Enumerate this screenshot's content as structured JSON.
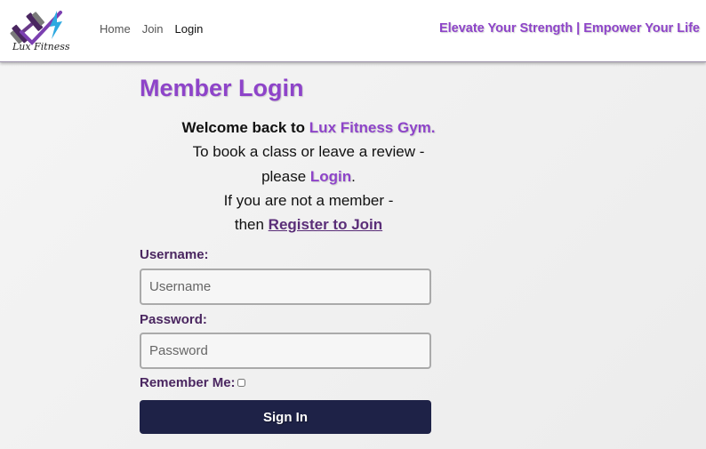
{
  "header": {
    "logo_text": "Lux Fitness",
    "nav": [
      {
        "label": "Home",
        "active": false
      },
      {
        "label": "Join",
        "active": false
      },
      {
        "label": "Login",
        "active": true
      }
    ],
    "tagline": "Elevate Your Strength | Empower Your Life"
  },
  "main": {
    "title": "Member Login",
    "welcome_prefix": "Welcome back to ",
    "gym_name": "Lux Fitness Gym.",
    "line2": "To book a class or leave a review -",
    "line3_prefix": "please ",
    "login_link": "Login",
    "line3_suffix": ".",
    "line4": "If you are not a member -",
    "line5_prefix": "then ",
    "register_link": "Register to Join"
  },
  "form": {
    "username_label": "Username:",
    "username_placeholder": "Username",
    "password_label": "Password:",
    "password_placeholder": "Password",
    "remember_label": "Remember Me:",
    "signin_label": "Sign In"
  },
  "colors": {
    "accent": "#8e44c9",
    "label": "#4a2660",
    "button": "#1e2247"
  }
}
